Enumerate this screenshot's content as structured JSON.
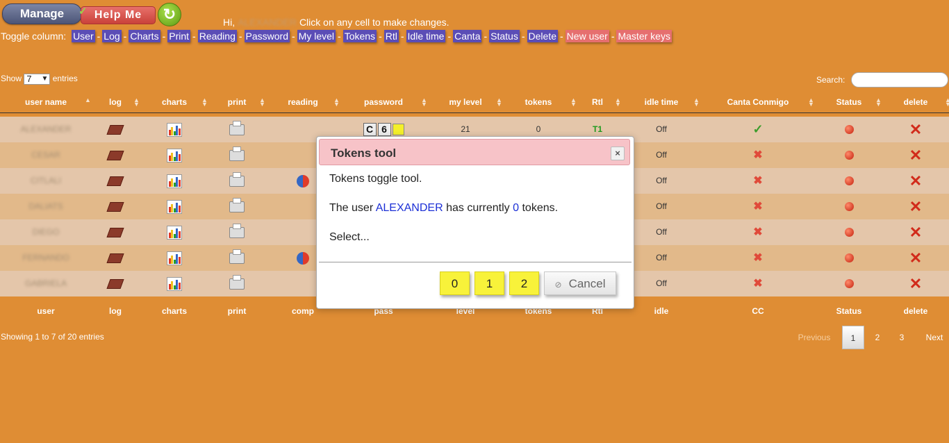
{
  "top": {
    "manage_label": "Manage",
    "help_label": "Help Me",
    "refresh_icon": "refresh-icon",
    "greeting_prefix": "Hi,",
    "greeting_name": "ALEXANDER",
    "greeting_suffix": "Click on any cell to make changes.",
    "toggle_label": "Toggle column:",
    "toggle_columns": [
      "User",
      "Log",
      "Charts",
      "Print",
      "Reading",
      "Password",
      "My level",
      "Tokens",
      "Rtl",
      "Idle time",
      "Canta",
      "Status",
      "Delete"
    ],
    "extra_buttons": [
      "New user",
      "Master keys"
    ]
  },
  "table_controls": {
    "show_prefix": "Show",
    "show_value": "7",
    "show_suffix": "entries",
    "search_label": "Search:"
  },
  "table": {
    "headers": [
      "user name",
      "log",
      "charts",
      "print",
      "reading",
      "password",
      "my level",
      "tokens",
      "Rtl",
      "idle time",
      "Canta Conmigo",
      "Status",
      "delete"
    ],
    "footers": [
      "user",
      "log",
      "charts",
      "print",
      "comp",
      "pass",
      "level",
      "tokens",
      "Rtl",
      "idle",
      "CC",
      "Status",
      "delete"
    ],
    "rows": [
      {
        "name": "ALEXANDER",
        "reading": "",
        "level": "21",
        "tokens": "0",
        "rtl": "T1",
        "idle": "Off",
        "cc": "check"
      },
      {
        "name": "CESAR",
        "reading": "",
        "level": "",
        "tokens": "",
        "rtl": "",
        "idle": "Off",
        "cc": "x"
      },
      {
        "name": "CITLALI",
        "reading": "pie",
        "level": "",
        "tokens": "",
        "rtl": "",
        "idle": "Off",
        "cc": "x"
      },
      {
        "name": "DALIATS",
        "reading": "",
        "level": "",
        "tokens": "",
        "rtl": "",
        "idle": "Off",
        "cc": "x"
      },
      {
        "name": "DIEGO",
        "reading": "",
        "level": "",
        "tokens": "",
        "rtl": "",
        "idle": "Off",
        "cc": "x"
      },
      {
        "name": "FERNANDO",
        "reading": "pie",
        "level": "",
        "tokens": "",
        "rtl": "",
        "idle": "Off",
        "cc": "x"
      },
      {
        "name": "GABRIELA",
        "reading": "",
        "level": "",
        "tokens": "",
        "rtl": "",
        "idle": "Off",
        "cc": "x"
      }
    ],
    "password_chars": [
      "C",
      "6"
    ]
  },
  "footer": {
    "showing": "Showing 1 to 7 of 20 entries",
    "previous": "Previous",
    "pages": [
      "1",
      "2",
      "3"
    ],
    "next": "Next"
  },
  "modal": {
    "title": "Tokens tool",
    "close": "×",
    "line1": "Tokens toggle tool.",
    "line2_a": "The user",
    "line2_user": "ALEXANDER",
    "line2_b": "has currently",
    "line2_tokens": "0",
    "line2_c": "tokens.",
    "line3": "Select...",
    "options": [
      "0",
      "1",
      "2"
    ],
    "cancel": "Cancel"
  },
  "colors": {
    "background": "#df8d34",
    "toggle_button": "#5b4db6",
    "toggle_button_alt": "#e66f6f",
    "modal_header": "#f7c3c8",
    "token_button": "#f8f23a"
  }
}
